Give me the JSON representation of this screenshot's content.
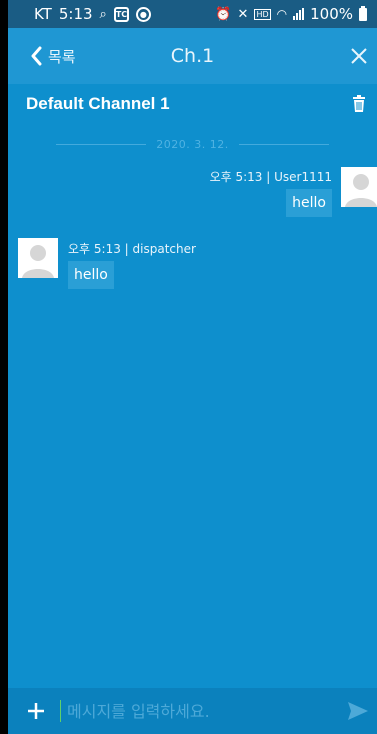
{
  "status": {
    "carrier": "KT",
    "time": "5:13",
    "hd_label": "HD",
    "battery": "100%",
    "left_icons": [
      "voicemail-icon",
      "app-notify-icon",
      "alert-icon"
    ],
    "right_icons": [
      "alarm-icon",
      "mute-icon",
      "wifi-icon",
      "signal-icon",
      "battery-icon"
    ]
  },
  "header": {
    "back_label": "목록",
    "title": "Ch.1"
  },
  "channel": {
    "name": "Default Channel 1"
  },
  "date_separator": "2020. 3. 12.",
  "messages": [
    {
      "side": "right",
      "meta": "오후 5:13 | User1111",
      "text": "hello"
    },
    {
      "side": "left",
      "meta": "오후 5:13 | dispatcher",
      "text": "hello"
    }
  ],
  "composer": {
    "placeholder": "메시지를 입력하세요."
  },
  "colors": {
    "background": "#0e8fcd",
    "header": "#1f97d3",
    "status_bar": "#1a5c84",
    "bubble": "#2a9fd6",
    "input_bar": "#0b81bd"
  }
}
